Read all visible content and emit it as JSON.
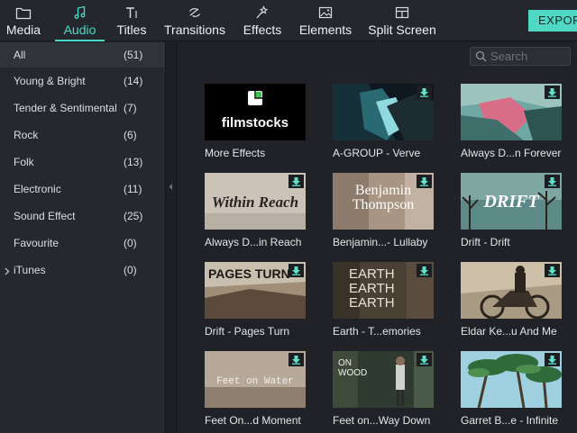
{
  "tabs": [
    {
      "label": "Media",
      "icon": "folder-icon",
      "active": false
    },
    {
      "label": "Audio",
      "icon": "music-note-icon",
      "active": true
    },
    {
      "label": "Titles",
      "icon": "text-icon",
      "active": false
    },
    {
      "label": "Transitions",
      "icon": "transition-icon",
      "active": false
    },
    {
      "label": "Effects",
      "icon": "magic-wand-icon",
      "active": false
    },
    {
      "label": "Elements",
      "icon": "image-icon",
      "active": false
    },
    {
      "label": "Split Screen",
      "icon": "split-screen-icon",
      "active": false
    }
  ],
  "export_label": "EXPORT",
  "colors": {
    "accent": "#49d9c4",
    "export_bg": "#4fd8c3",
    "download_arrow": "#5fe0c8"
  },
  "categories": [
    {
      "name": "All",
      "count": "(51)",
      "selected": true
    },
    {
      "name": "Young & Bright",
      "count": "(14)"
    },
    {
      "name": "Tender & Sentimental",
      "count": "(7)"
    },
    {
      "name": "Rock",
      "count": "(6)"
    },
    {
      "name": "Folk",
      "count": "(13)"
    },
    {
      "name": "Electronic",
      "count": "(11)"
    },
    {
      "name": "Sound Effect",
      "count": "(25)"
    },
    {
      "name": "Favourite",
      "count": "(0)"
    },
    {
      "name": "iTunes",
      "count": "(0)",
      "expandable": true
    }
  ],
  "search": {
    "placeholder": "Search",
    "value": ""
  },
  "tracks": [
    {
      "label": "More Effects",
      "thumb_text": "filmstocks",
      "downloadable": false
    },
    {
      "label": "A-GROUP - Verve",
      "downloadable": true
    },
    {
      "label": "Always D...n Forever",
      "downloadable": true
    },
    {
      "label": "Always D...in Reach",
      "thumb_text": "Within Reach",
      "downloadable": true
    },
    {
      "label": "Benjamin...- Lullaby",
      "thumb_text": "Benjamin Thompson",
      "downloadable": true
    },
    {
      "label": "Drift - Drift",
      "thumb_text": "DRIFT",
      "downloadable": true
    },
    {
      "label": "Drift - Pages Turn",
      "thumb_text": "PAGES TURN",
      "downloadable": true
    },
    {
      "label": "Earth - T...emories",
      "thumb_text": "EARTH EARTH EARTH",
      "downloadable": true
    },
    {
      "label": "Eldar Ke...u And Me",
      "downloadable": true
    },
    {
      "label": "Feet On...d Moment",
      "thumb_text": "Feet on Water",
      "downloadable": true
    },
    {
      "label": "Feet on...Way Down",
      "thumb_text": "ON WOOD",
      "downloadable": true
    },
    {
      "label": "Garret B...e - Infinite",
      "downloadable": true
    }
  ]
}
